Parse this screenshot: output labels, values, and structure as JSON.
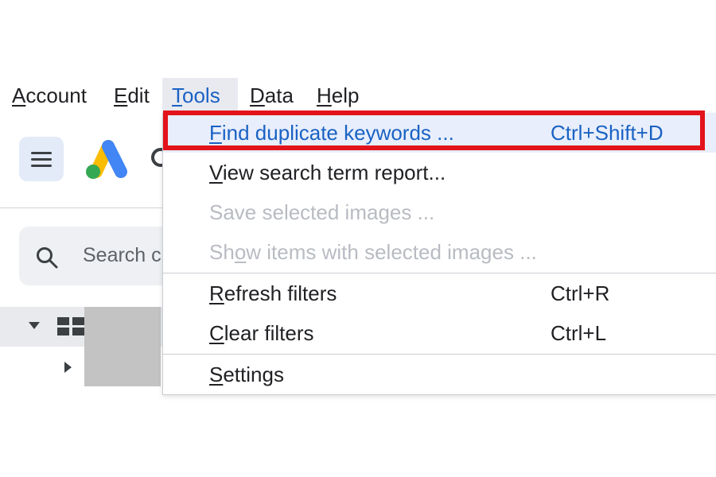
{
  "menubar": {
    "items": [
      {
        "label": "Account",
        "mnemonic": "A",
        "rest": "ccount"
      },
      {
        "label": "Edit",
        "mnemonic": "E",
        "rest": "dit"
      },
      {
        "label": "Tools",
        "mnemonic": "T",
        "rest": "ools",
        "active": true
      },
      {
        "label": "Data",
        "mnemonic": "D",
        "rest": "ata"
      },
      {
        "label": "Help",
        "mnemonic": "H",
        "rest": "elp"
      }
    ]
  },
  "search": {
    "placeholder": "Search c"
  },
  "tools_menu": {
    "items": [
      {
        "label": "Find duplicate keywords ...",
        "mnemonic": "F",
        "rest": "ind duplicate keywords ...",
        "shortcut": "Ctrl+Shift+D",
        "state": "highlighted"
      },
      {
        "label": "View search term report...",
        "mnemonic": "V",
        "rest": "iew search term report...",
        "shortcut": "",
        "state": "enabled"
      },
      {
        "label": "Save selected images ...",
        "mnemonic": "",
        "rest": "Save selected images ...",
        "shortcut": "",
        "state": "disabled"
      },
      {
        "label": "Show items with selected images ...",
        "pre": "Sh",
        "mnemonic": "o",
        "rest": "w items with selected images ...",
        "shortcut": "",
        "state": "disabled"
      },
      {
        "label": "Refresh filters",
        "mnemonic": "R",
        "rest": "efresh filters",
        "shortcut": "Ctrl+R",
        "state": "enabled"
      },
      {
        "label": "Clear filters",
        "mnemonic": "C",
        "rest": "lear filters",
        "shortcut": "Ctrl+L",
        "state": "enabled"
      },
      {
        "label": "Settings",
        "mnemonic": "S",
        "rest": "ettings",
        "shortcut": "",
        "state": "enabled"
      }
    ]
  },
  "colors": {
    "highlight_frame": "#e3131b",
    "menu_active_text": "#1a62c4",
    "disabled_text": "#b8bcc2",
    "logo_blue": "#4285f4",
    "logo_yellow": "#fbbc04",
    "logo_green": "#34a853"
  },
  "icons": [
    "hamburger-menu-icon",
    "google-ads-logo",
    "search-icon",
    "caret-down-icon",
    "grid-icon",
    "caret-right-icon"
  ]
}
